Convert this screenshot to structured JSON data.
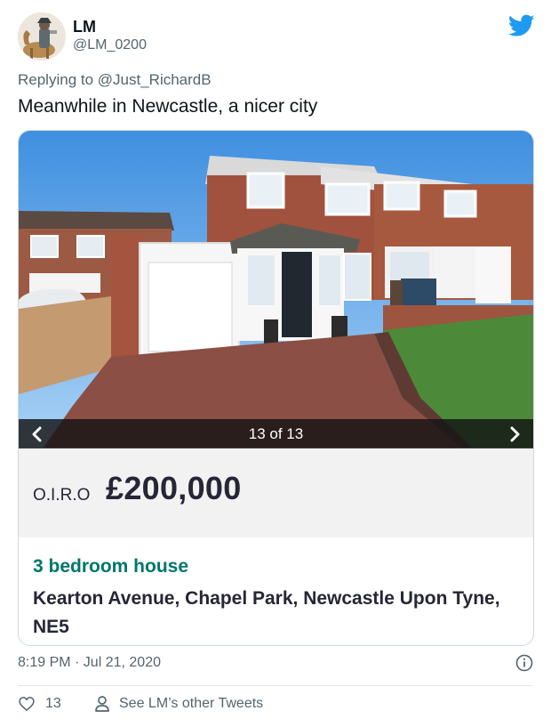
{
  "user": {
    "display_name": "LM",
    "handle": "@LM_0200"
  },
  "reply_to": "Replying to @Just_RichardB",
  "tweet_text": "Meanwhile in Newcastle, a nicer city",
  "card": {
    "photo_counter": "13 of 13",
    "price_qualifier": "O.I.R.O",
    "price": "£200,000",
    "property_type": "3 bedroom house",
    "address": "Kearton Avenue, Chapel Park, Newcastle Upon Tyne, NE5"
  },
  "timestamp": "8:19 PM · Jul 21, 2020",
  "footer": {
    "like_count": "13",
    "other_tweets_label": "See LM’s other Tweets"
  },
  "colors": {
    "twitter_blue": "#1d9bf0",
    "listing_green": "#00766b",
    "muted_text": "#536471"
  },
  "icons": [
    "twitter-logo-icon",
    "chevron-left-icon",
    "chevron-right-icon",
    "info-icon",
    "heart-icon",
    "person-icon"
  ]
}
